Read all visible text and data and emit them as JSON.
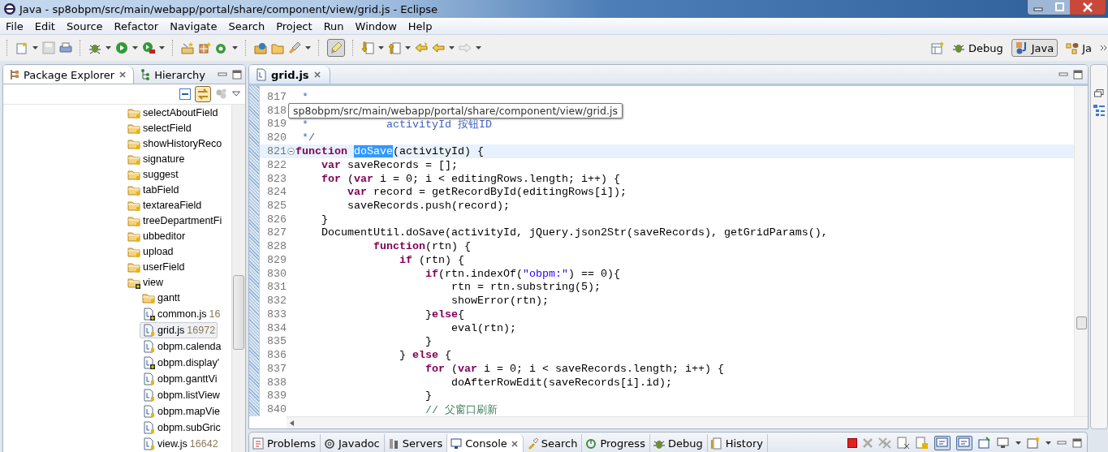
{
  "window": {
    "title": "Java - sp8obpm/src/main/webapp/portal/share/component/view/grid.js - Eclipse"
  },
  "menu": [
    "File",
    "Edit",
    "Source",
    "Refactor",
    "Navigate",
    "Search",
    "Project",
    "Run",
    "Window",
    "Help"
  ],
  "toolbar": {
    "mark_occurrences": {
      "on": true
    }
  },
  "perspectives": [
    {
      "label": "Debug",
      "selected": false
    },
    {
      "label": "Java",
      "selected": true
    },
    {
      "label": "Ja",
      "selected": false
    }
  ],
  "explorer": {
    "tabs": [
      {
        "label": "Package Explorer",
        "selected": true
      },
      {
        "label": "Hierarchy",
        "selected": false
      }
    ],
    "link_with_editor": {
      "on": true
    },
    "tree": [
      {
        "label": "selectAboutField",
        "kind": "folder",
        "overlay": false,
        "selected": false
      },
      {
        "label": "selectField",
        "kind": "folder",
        "overlay": false,
        "selected": false
      },
      {
        "label": "showHistoryReco",
        "kind": "folder",
        "overlay": false,
        "selected": false
      },
      {
        "label": "signature",
        "kind": "folder",
        "overlay": false,
        "selected": false
      },
      {
        "label": "suggest",
        "kind": "folder",
        "overlay": false,
        "selected": false
      },
      {
        "label": "tabField",
        "kind": "folder",
        "overlay": false,
        "selected": false
      },
      {
        "label": "textareaField",
        "kind": "folder",
        "overlay": false,
        "selected": false
      },
      {
        "label": "treeDepartmentFi",
        "kind": "folder",
        "overlay": false,
        "selected": false
      },
      {
        "label": "ubbeditor",
        "kind": "folder",
        "overlay": false,
        "selected": false
      },
      {
        "label": "upload",
        "kind": "folder",
        "overlay": false,
        "selected": false
      },
      {
        "label": "userField",
        "kind": "folder",
        "overlay": false,
        "selected": false
      },
      {
        "label": "view",
        "kind": "folder",
        "overlay": true,
        "selected": false,
        "expanded": true,
        "children": [
          {
            "label": "gantt",
            "kind": "folder",
            "overlay": false,
            "selected": false
          },
          {
            "label": "common.js",
            "revision": "16",
            "kind": "js",
            "overlay": true,
            "selected": false
          },
          {
            "label": "grid.js",
            "revision": "16972",
            "kind": "js",
            "overlay": false,
            "selected": true
          },
          {
            "label": "obpm.calenda",
            "kind": "js",
            "overlay": false,
            "selected": false
          },
          {
            "label": "obpm.display'",
            "kind": "js",
            "overlay": true,
            "selected": false
          },
          {
            "label": "obpm.ganttVi",
            "kind": "js",
            "overlay": false,
            "selected": false
          },
          {
            "label": "obpm.listView",
            "kind": "js",
            "overlay": false,
            "selected": false
          },
          {
            "label": "obpm.mapVie",
            "kind": "js",
            "overlay": false,
            "selected": false
          },
          {
            "label": "obpm.subGric",
            "kind": "js",
            "overlay": false,
            "selected": false
          },
          {
            "label": "view.js",
            "revision": "16642",
            "kind": "js",
            "overlay": false,
            "selected": false
          }
        ]
      }
    ]
  },
  "editor": {
    "tabs": [
      {
        "label": "grid.js",
        "selected": true
      }
    ],
    "tooltip": "sp8obpm/src/main/webapp/portal/share/component/view/grid.js",
    "lines": [
      {
        "number": "817",
        "current": false,
        "tokens": [
          {
            "kind": "doc",
            "text": " *"
          }
        ]
      },
      {
        "number": "818",
        "current": false
      },
      {
        "number": "819",
        "current": false,
        "tokens": [
          {
            "kind": "doc",
            "text": " *            activityId 按钮ID"
          }
        ]
      },
      {
        "number": "820",
        "current": false,
        "tokens": [
          {
            "kind": "doc",
            "text": " */"
          }
        ]
      },
      {
        "number": "821",
        "current": true,
        "fold": true,
        "tokens": [
          {
            "kind": "keyword",
            "text": "function "
          },
          {
            "kind": "selection",
            "text": "doSave"
          },
          {
            "kind": "plain",
            "text": "(activityId) {"
          }
        ]
      },
      {
        "number": "822",
        "current": false,
        "tokens": [
          {
            "kind": "keyword",
            "text": "    var"
          },
          {
            "kind": "plain",
            "text": " saveRecords = [];"
          }
        ]
      },
      {
        "number": "823",
        "current": false,
        "tokens": [
          {
            "kind": "keyword",
            "text": "    for"
          },
          {
            "kind": "plain",
            "text": " ("
          },
          {
            "kind": "keyword",
            "text": "var"
          },
          {
            "kind": "plain",
            "text": " i = 0; i < editingRows.length; i++) {"
          }
        ]
      },
      {
        "number": "824",
        "current": false,
        "tokens": [
          {
            "kind": "keyword",
            "text": "        var"
          },
          {
            "kind": "plain",
            "text": " record = getRecordById(editingRows[i]);"
          }
        ]
      },
      {
        "number": "825",
        "current": false,
        "tokens": [
          {
            "kind": "plain",
            "text": "        saveRecords.push(record);"
          }
        ]
      },
      {
        "number": "826",
        "current": false,
        "tokens": [
          {
            "kind": "plain",
            "text": "    }"
          }
        ]
      },
      {
        "number": "827",
        "current": false,
        "tokens": [
          {
            "kind": "plain",
            "text": "    DocumentUtil.doSave(activityId, jQuery.json2Str(saveRecords), getGridParams(),"
          }
        ]
      },
      {
        "number": "828",
        "current": false,
        "tokens": [
          {
            "kind": "keyword",
            "text": "            function"
          },
          {
            "kind": "plain",
            "text": "(rtn) {"
          }
        ]
      },
      {
        "number": "829",
        "current": false,
        "tokens": [
          {
            "kind": "keyword",
            "text": "                if"
          },
          {
            "kind": "plain",
            "text": " (rtn) {"
          }
        ]
      },
      {
        "number": "830",
        "current": false,
        "tokens": [
          {
            "kind": "keyword",
            "text": "                    if"
          },
          {
            "kind": "plain",
            "text": "(rtn.indexOf("
          },
          {
            "kind": "string",
            "text": "\"obpm:\""
          },
          {
            "kind": "plain",
            "text": ") == 0){"
          }
        ]
      },
      {
        "number": "831",
        "current": false,
        "tokens": [
          {
            "kind": "plain",
            "text": "                        rtn = rtn.substring(5);"
          }
        ]
      },
      {
        "number": "832",
        "current": false,
        "tokens": [
          {
            "kind": "plain",
            "text": "                        showError(rtn);"
          }
        ]
      },
      {
        "number": "833",
        "current": false,
        "tokens": [
          {
            "kind": "plain",
            "text": "                    }"
          },
          {
            "kind": "keyword",
            "text": "else"
          },
          {
            "kind": "plain",
            "text": "{"
          }
        ]
      },
      {
        "number": "834",
        "current": false,
        "tokens": [
          {
            "kind": "plain",
            "text": "                        eval(rtn);"
          }
        ]
      },
      {
        "number": "835",
        "current": false,
        "tokens": [
          {
            "kind": "plain",
            "text": "                    }"
          }
        ]
      },
      {
        "number": "836",
        "current": false,
        "tokens": [
          {
            "kind": "plain",
            "text": "                } "
          },
          {
            "kind": "keyword",
            "text": "else"
          },
          {
            "kind": "plain",
            "text": " {"
          }
        ]
      },
      {
        "number": "837",
        "current": false,
        "tokens": [
          {
            "kind": "keyword",
            "text": "                    for"
          },
          {
            "kind": "plain",
            "text": " ("
          },
          {
            "kind": "keyword",
            "text": "var"
          },
          {
            "kind": "plain",
            "text": " i = 0; i < saveRecords.length; i++) {"
          }
        ]
      },
      {
        "number": "838",
        "current": false,
        "tokens": [
          {
            "kind": "plain",
            "text": "                        doAfterRowEdit(saveRecords[i].id);"
          }
        ]
      },
      {
        "number": "839",
        "current": false,
        "tokens": [
          {
            "kind": "plain",
            "text": "                    }"
          }
        ]
      },
      {
        "number": "840",
        "current": false,
        "tokens": [
          {
            "kind": "comment",
            "text": "                    // 父窗口刷新"
          }
        ]
      }
    ]
  },
  "bottom_panel": {
    "tabs": [
      {
        "label": "Problems",
        "selected": false
      },
      {
        "label": "Javadoc",
        "selected": false
      },
      {
        "label": "Servers",
        "selected": false
      },
      {
        "label": "Console",
        "selected": true
      },
      {
        "label": "Search",
        "selected": false
      },
      {
        "label": "Progress",
        "selected": false
      },
      {
        "label": "Debug",
        "selected": false
      },
      {
        "label": "History",
        "selected": false
      }
    ],
    "pin_console": {
      "on": true
    },
    "show_on_output": {
      "on": true
    }
  }
}
